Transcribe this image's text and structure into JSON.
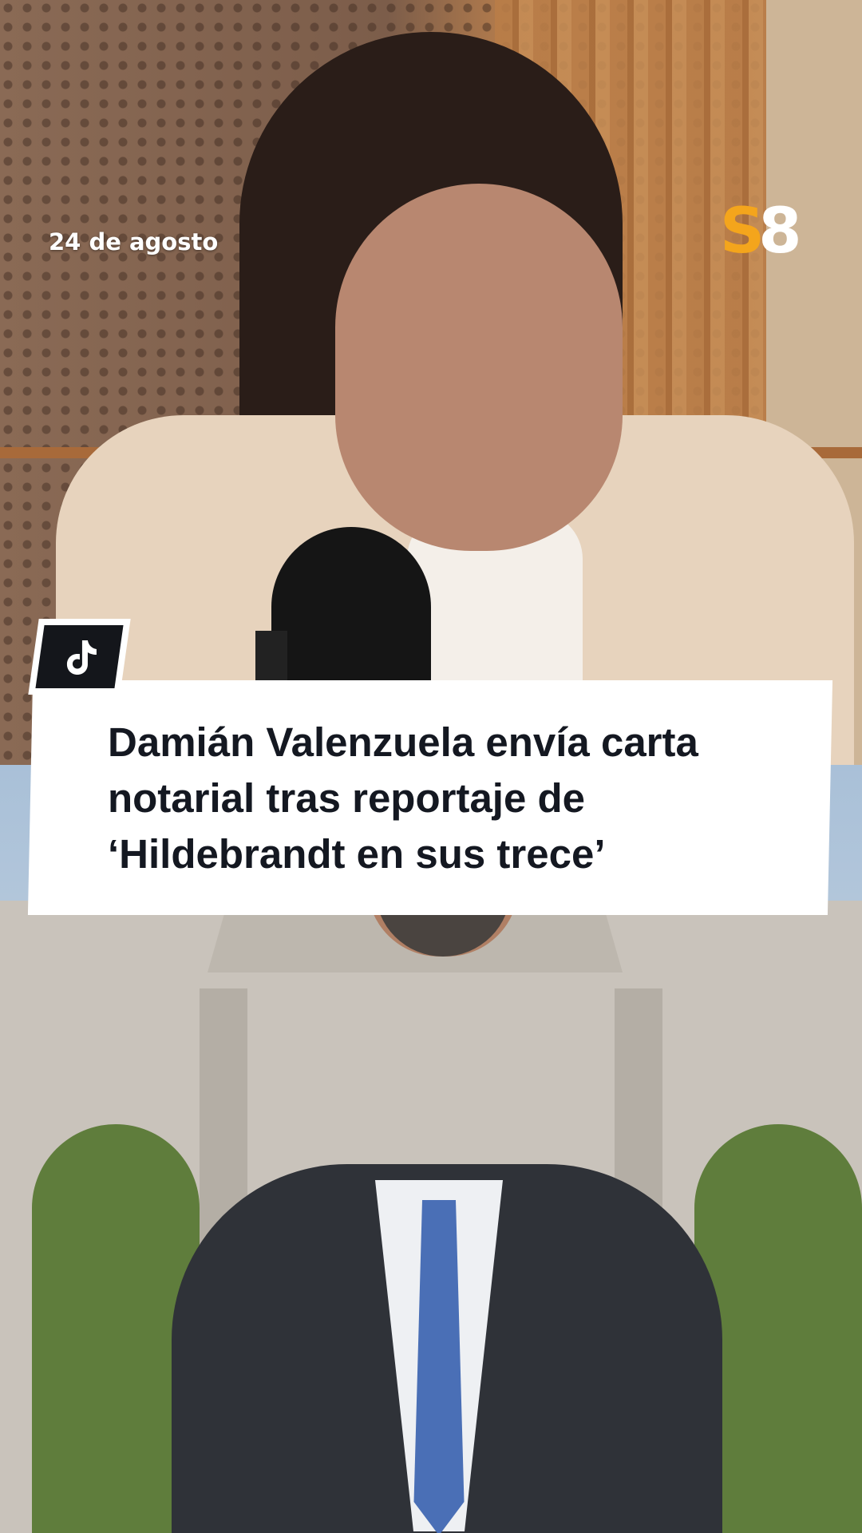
{
  "date": "24 de agosto",
  "logo": {
    "s": "S",
    "eight": "8",
    "accent_color": "#f4a51c"
  },
  "platform_icon": "tiktok-icon",
  "headline": {
    "line1": "Damián Valenzuela envía carta",
    "line2": "notarial tras reportaje de",
    "line3": "‘Hildebrandt en sus trece’"
  }
}
